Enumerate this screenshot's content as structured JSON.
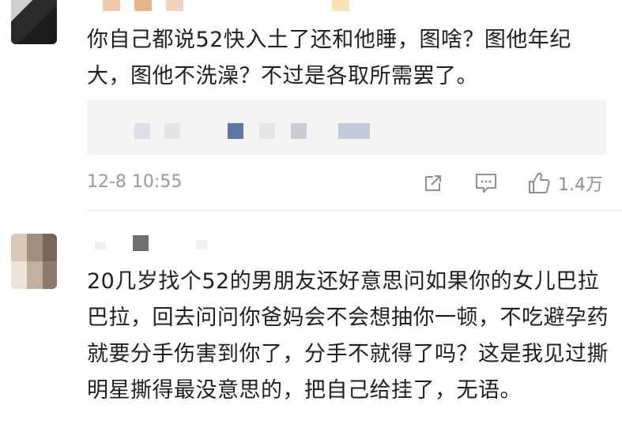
{
  "comments": [
    {
      "text": "你自己都说52快入土了还和他睡，图啥？图他年纪大，图他不洗澡？不过是各取所需罢了。",
      "timestamp": "12-8 10:55",
      "likes": "1.4万"
    },
    {
      "text": "20几岁找个52的男朋友还好意思问如果你的女儿巴拉巴拉，回去问问你爸妈会不会想抽你一顿，不吃避孕药就要分手伤害到你了，分手不就得了吗？这是我见过撕明星撕得最没意思的，把自己给挂了，无语。"
    }
  ],
  "icons": {
    "share": "share-icon",
    "comment": "comment-icon",
    "like": "thumbs-up-icon"
  },
  "colors": {
    "text": "#1f1f1f",
    "meta": "#9a9a9a",
    "reply_bg": "#f3f3f3"
  }
}
